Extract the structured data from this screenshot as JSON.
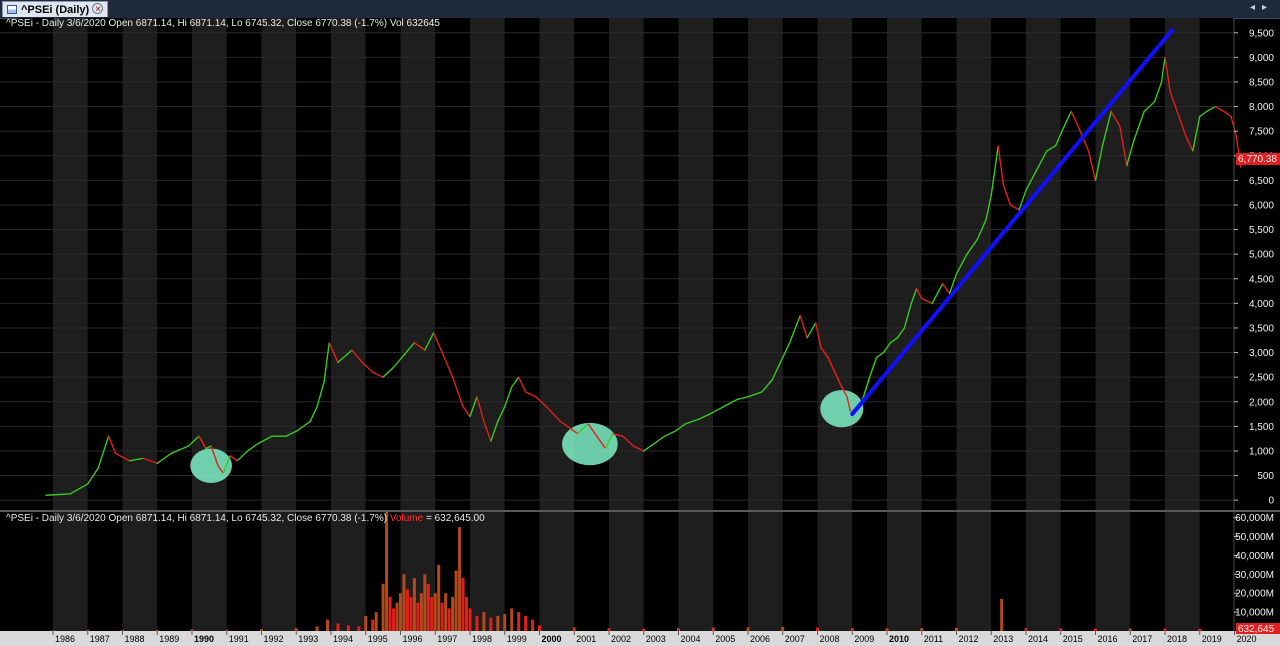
{
  "window": {
    "tab_label": "^PSEi (Daily)",
    "close_glyph": "×",
    "nav_left": "◂",
    "nav_right": "▸"
  },
  "colors": {
    "background": "#000000",
    "band_light": "#1e1e1e",
    "up": "#39c81e",
    "down": "#e0201a",
    "trendline": "#1010ff",
    "highlight": "#7ff0c8",
    "last_value_tag": "#e02020"
  },
  "price_panel": {
    "info": "^PSEi - Daily 3/6/2020 Open 6871.14, Hi 6871.14, Lo 6745.32, Close 6770.38 (-1.7%) Vol 632645",
    "last_value_label": "6,770.38"
  },
  "volume_panel": {
    "info_prefix": "^PSEi - Daily 3/6/2020 Open 6871.14, Hi 6871.14, Lo 6745.32, Close 6770.38 (-1.7%)",
    "info_volume_label": "Volume",
    "info_volume_value": "= 632,645.00",
    "last_value_label": "632,645"
  },
  "chart_data": {
    "type": "line",
    "x_ticks": [
      "1986",
      "1987",
      "1988",
      "1989",
      "1990",
      "1991",
      "1992",
      "1993",
      "1994",
      "1995",
      "1996",
      "1997",
      "1998",
      "1999",
      "2000",
      "2001",
      "2002",
      "2003",
      "2004",
      "2005",
      "2006",
      "2007",
      "2008",
      "2009",
      "2010",
      "2011",
      "2012",
      "2013",
      "2014",
      "2015",
      "2016",
      "2017",
      "2018",
      "2019",
      "2020"
    ],
    "bold_years": [
      1990,
      2000,
      2010
    ],
    "price_axis": {
      "range": [
        -200,
        9800
      ],
      "ticks": [
        0,
        500,
        1000,
        1500,
        2000,
        2500,
        3000,
        3500,
        4000,
        4500,
        5000,
        5500,
        6000,
        6500,
        7000,
        7500,
        8000,
        8500,
        9000,
        9500
      ],
      "tick_labels": [
        "0",
        "500",
        "1,000",
        "1,500",
        "2,000",
        "2,500",
        "3,000",
        "3,500",
        "4,000",
        "4,500",
        "5,000",
        "5,500",
        "6,000",
        "6,500",
        "7,000",
        "7,500",
        "8,000",
        "8,500",
        "9,000",
        "9,500"
      ]
    },
    "volume_axis": {
      "range": [
        0,
        63000000
      ],
      "ticks": [
        10000000,
        20000000,
        30000000,
        40000000,
        50000000,
        60000000
      ],
      "tick_labels": [
        "10,000M",
        "20,000M",
        "30,000M",
        "40,000M",
        "50,000M",
        "60,000M"
      ]
    },
    "price_series": {
      "name": "^PSEi",
      "points": [
        [
          1985.8,
          100
        ],
        [
          1986.5,
          130
        ],
        [
          1987.0,
          330
        ],
        [
          1987.3,
          650
        ],
        [
          1987.6,
          1300
        ],
        [
          1987.8,
          950
        ],
        [
          1988.2,
          800
        ],
        [
          1988.6,
          850
        ],
        [
          1989.0,
          750
        ],
        [
          1989.4,
          950
        ],
        [
          1989.9,
          1100
        ],
        [
          1990.2,
          1300
        ],
        [
          1990.4,
          1050
        ],
        [
          1990.55,
          1100
        ],
        [
          1990.75,
          700
        ],
        [
          1990.9,
          550
        ],
        [
          1991.1,
          900
        ],
        [
          1991.3,
          800
        ],
        [
          1991.6,
          1000
        ],
        [
          1991.9,
          1150
        ],
        [
          1992.3,
          1300
        ],
        [
          1992.7,
          1300
        ],
        [
          1993.0,
          1400
        ],
        [
          1993.4,
          1600
        ],
        [
          1993.6,
          1900
        ],
        [
          1993.8,
          2400
        ],
        [
          1993.95,
          3200
        ],
        [
          1994.2,
          2800
        ],
        [
          1994.6,
          3050
        ],
        [
          1994.9,
          2800
        ],
        [
          1995.2,
          2600
        ],
        [
          1995.5,
          2500
        ],
        [
          1995.8,
          2700
        ],
        [
          1996.1,
          2950
        ],
        [
          1996.4,
          3200
        ],
        [
          1996.7,
          3050
        ],
        [
          1996.95,
          3400
        ],
        [
          1997.2,
          3000
        ],
        [
          1997.5,
          2500
        ],
        [
          1997.8,
          1900
        ],
        [
          1998.0,
          1700
        ],
        [
          1998.2,
          2100
        ],
        [
          1998.4,
          1600
        ],
        [
          1998.6,
          1200
        ],
        [
          1998.8,
          1600
        ],
        [
          1999.0,
          1900
        ],
        [
          1999.2,
          2300
        ],
        [
          1999.4,
          2500
        ],
        [
          1999.6,
          2200
        ],
        [
          1999.9,
          2100
        ],
        [
          2000.2,
          1900
        ],
        [
          2000.6,
          1600
        ],
        [
          2000.9,
          1450
        ],
        [
          2001.1,
          1350
        ],
        [
          2001.4,
          1550
        ],
        [
          2001.7,
          1250
        ],
        [
          2001.9,
          1050
        ],
        [
          2002.1,
          1350
        ],
        [
          2002.4,
          1300
        ],
        [
          2002.7,
          1100
        ],
        [
          2003.0,
          1000
        ],
        [
          2003.3,
          1150
        ],
        [
          2003.6,
          1300
        ],
        [
          2003.9,
          1400
        ],
        [
          2004.2,
          1550
        ],
        [
          2004.6,
          1650
        ],
        [
          2004.9,
          1750
        ],
        [
          2005.3,
          1900
        ],
        [
          2005.7,
          2050
        ],
        [
          2006.0,
          2100
        ],
        [
          2006.4,
          2200
        ],
        [
          2006.7,
          2450
        ],
        [
          2007.0,
          2900
        ],
        [
          2007.2,
          3200
        ],
        [
          2007.5,
          3750
        ],
        [
          2007.7,
          3300
        ],
        [
          2007.95,
          3600
        ],
        [
          2008.1,
          3100
        ],
        [
          2008.3,
          2900
        ],
        [
          2008.5,
          2600
        ],
        [
          2008.7,
          2300
        ],
        [
          2008.85,
          2100
        ],
        [
          2008.95,
          1800
        ],
        [
          2009.1,
          1850
        ],
        [
          2009.3,
          2050
        ],
        [
          2009.5,
          2500
        ],
        [
          2009.7,
          2900
        ],
        [
          2009.9,
          3000
        ],
        [
          2010.1,
          3200
        ],
        [
          2010.3,
          3300
        ],
        [
          2010.5,
          3500
        ],
        [
          2010.7,
          4000
        ],
        [
          2010.85,
          4300
        ],
        [
          2011.0,
          4100
        ],
        [
          2011.3,
          4000
        ],
        [
          2011.6,
          4400
        ],
        [
          2011.8,
          4200
        ],
        [
          2012.0,
          4600
        ],
        [
          2012.3,
          5000
        ],
        [
          2012.6,
          5300
        ],
        [
          2012.85,
          5700
        ],
        [
          2013.0,
          6200
        ],
        [
          2013.2,
          7200
        ],
        [
          2013.35,
          6400
        ],
        [
          2013.55,
          6000
        ],
        [
          2013.8,
          5900
        ],
        [
          2014.0,
          6300
        ],
        [
          2014.3,
          6700
        ],
        [
          2014.6,
          7100
        ],
        [
          2014.85,
          7200
        ],
        [
          2015.1,
          7600
        ],
        [
          2015.3,
          7900
        ],
        [
          2015.5,
          7600
        ],
        [
          2015.8,
          7100
        ],
        [
          2016.0,
          6500
        ],
        [
          2016.2,
          7200
        ],
        [
          2016.45,
          7900
        ],
        [
          2016.7,
          7600
        ],
        [
          2016.9,
          6800
        ],
        [
          2017.1,
          7300
        ],
        [
          2017.4,
          7900
        ],
        [
          2017.7,
          8100
        ],
        [
          2017.9,
          8500
        ],
        [
          2018.0,
          9000
        ],
        [
          2018.15,
          8300
        ],
        [
          2018.4,
          7800
        ],
        [
          2018.6,
          7400
        ],
        [
          2018.8,
          7100
        ],
        [
          2019.0,
          7800
        ],
        [
          2019.2,
          7900
        ],
        [
          2019.45,
          8000
        ],
        [
          2019.7,
          7900
        ],
        [
          2019.9,
          7800
        ],
        [
          2020.05,
          7400
        ],
        [
          2020.18,
          6770
        ]
      ]
    },
    "volume_series": {
      "name": "Volume",
      "bars": [
        [
          1986.0,
          300
        ],
        [
          1987.0,
          600
        ],
        [
          1988.0,
          500
        ],
        [
          1989.0,
          600
        ],
        [
          1990.0,
          800
        ],
        [
          1991.0,
          700
        ],
        [
          1992.0,
          900
        ],
        [
          1993.0,
          1500
        ],
        [
          1993.6,
          2500
        ],
        [
          1993.9,
          6000
        ],
        [
          1994.2,
          4000
        ],
        [
          1994.5,
          3000
        ],
        [
          1994.8,
          2500
        ],
        [
          1995.0,
          8000
        ],
        [
          1995.2,
          6000
        ],
        [
          1995.3,
          10000
        ],
        [
          1995.5,
          25000
        ],
        [
          1995.6,
          63000
        ],
        [
          1995.7,
          18000
        ],
        [
          1995.8,
          12000
        ],
        [
          1995.9,
          15000
        ],
        [
          1996.0,
          20000
        ],
        [
          1996.1,
          30000
        ],
        [
          1996.2,
          22000
        ],
        [
          1996.3,
          18000
        ],
        [
          1996.4,
          28000
        ],
        [
          1996.5,
          15000
        ],
        [
          1996.6,
          20000
        ],
        [
          1996.7,
          30000
        ],
        [
          1996.8,
          25000
        ],
        [
          1996.9,
          18000
        ],
        [
          1997.0,
          20000
        ],
        [
          1997.1,
          35000
        ],
        [
          1997.2,
          15000
        ],
        [
          1997.3,
          20000
        ],
        [
          1997.4,
          12000
        ],
        [
          1997.5,
          18000
        ],
        [
          1997.6,
          32000
        ],
        [
          1997.7,
          55000
        ],
        [
          1997.8,
          28000
        ],
        [
          1997.9,
          18000
        ],
        [
          1998.0,
          12000
        ],
        [
          1998.2,
          8000
        ],
        [
          1998.4,
          10000
        ],
        [
          1998.6,
          7000
        ],
        [
          1998.8,
          8000
        ],
        [
          1999.0,
          9000
        ],
        [
          1999.2,
          12000
        ],
        [
          1999.4,
          10000
        ],
        [
          1999.6,
          8000
        ],
        [
          1999.8,
          6000
        ],
        [
          2000.0,
          3000
        ],
        [
          2001.0,
          2000
        ],
        [
          2002.0,
          1500
        ],
        [
          2003.0,
          1200
        ],
        [
          2004.0,
          1500
        ],
        [
          2005.0,
          1800
        ],
        [
          2006.0,
          2000
        ],
        [
          2007.0,
          2200
        ],
        [
          2008.0,
          1800
        ],
        [
          2009.0,
          1500
        ],
        [
          2010.0,
          1500
        ],
        [
          2011.0,
          1600
        ],
        [
          2012.0,
          1700
        ],
        [
          2013.3,
          17000
        ],
        [
          2014.0,
          1500
        ],
        [
          2015.0,
          1400
        ],
        [
          2016.0,
          1300
        ],
        [
          2017.0,
          1400
        ],
        [
          2018.0,
          1300
        ],
        [
          2019.0,
          1200
        ],
        [
          2020.1,
          632
        ]
      ]
    },
    "trendline": {
      "from": [
        2009.0,
        1750
      ],
      "to": [
        2018.2,
        9550
      ]
    },
    "highlights": [
      {
        "center": [
          1990.55,
          700
        ],
        "rx_years": 0.6,
        "ry_price": 350
      },
      {
        "center": [
          2001.45,
          1140
        ],
        "rx_years": 0.8,
        "ry_price": 430
      },
      {
        "center": [
          2008.7,
          1860
        ],
        "rx_years": 0.62,
        "ry_price": 380
      }
    ]
  }
}
